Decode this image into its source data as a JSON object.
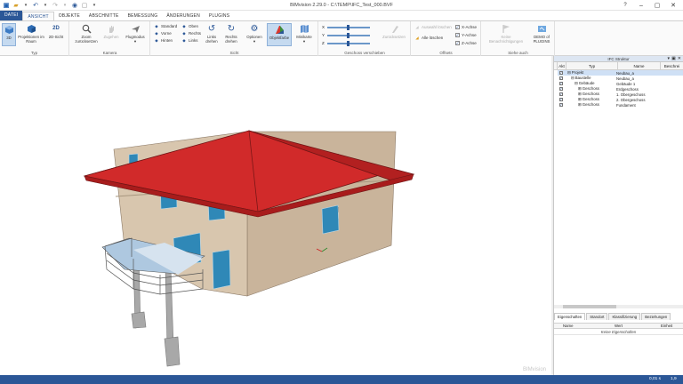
{
  "window": {
    "title": "BIMvision 2.29.0 - C:\\TEMP\\IFC_Test_000.BVF"
  },
  "tabs": [
    {
      "label": "DATEI"
    },
    {
      "label": "ANSICHT"
    },
    {
      "label": "OBJEKTE"
    },
    {
      "label": "ABSCHNITTE"
    },
    {
      "label": "BEMESSUNG"
    },
    {
      "label": "ÄNDERUNGEN"
    },
    {
      "label": "PLUGINS"
    }
  ],
  "ribbon": {
    "typ": {
      "name": "Typ",
      "btn_3d": "3D",
      "btn_projektionen": "Projektionen im Raum",
      "btn_2d": "2D-Sicht"
    },
    "kamera": {
      "name": "Kamera",
      "btn_zoom": "Zoom zurücksetzen",
      "btn_zugehen": "Zugehen",
      "btn_flugmodus": "Flugmodus"
    },
    "sicht": {
      "name": "Sicht",
      "standard": "Standard",
      "vorne": "Vorne",
      "hinten": "Hinten",
      "oben": "Oben",
      "rechts": "Rechts",
      "links": "Links",
      "links_drehen": "Links drehen",
      "rechts_drehen": "Rechts drehen",
      "optionen": "Optionen",
      "objektfarbe": "Objektfarbe",
      "minikarte": "Minikarte"
    },
    "geschoss": {
      "name": "Geschoss verschieben",
      "x": "X",
      "y": "Y",
      "z": "Z",
      "zuruecksetzen": "Zurücksetzen"
    },
    "offsets": {
      "name": "Offsets",
      "auswahl_loeschen": "Auswahl löschen",
      "alle_loeschen": "Alle löschen",
      "x_achse": "X-Achse",
      "y_achse": "Y-Achse",
      "z_achse": "Z-Achse"
    },
    "siehe_auch": {
      "name": "Siehe auch",
      "keine_benachrichtigungen": "Keine Benachrichtigungen",
      "demo_plugins": "DEMO of PLUGINS"
    }
  },
  "ifc_panel": {
    "title": "IFC Struktur",
    "columns": {
      "akt": "Akt",
      "typ": "Typ",
      "name": "Name",
      "beschr": "Beschrei"
    },
    "rows": [
      {
        "typ": "Projekt",
        "name": "Neubau_a"
      },
      {
        "typ": "Baustelle",
        "name": "Neubau_a"
      },
      {
        "typ": "Gebäude",
        "name": "Gebäude 1"
      },
      {
        "typ": "Geschoss",
        "name": "Erdgeschoss"
      },
      {
        "typ": "Geschoss",
        "name": "1. Obergeschoss"
      },
      {
        "typ": "Geschoss",
        "name": "2. Obergeschoss"
      },
      {
        "typ": "Geschoss",
        "name": "Fundament"
      }
    ]
  },
  "props_panel": {
    "tabs": [
      {
        "label": "Eigenschaften"
      },
      {
        "label": "Standort"
      },
      {
        "label": "Klassifizierung"
      },
      {
        "label": "Beziehungen"
      }
    ],
    "col_name": "Name",
    "col_wert": "Wert",
    "col_einheit": "Einheit",
    "empty_text": "Keine Eigenschaften"
  },
  "viewport": {
    "watermark": "BIMvision"
  },
  "status": {
    "left": "0,01 s",
    "right": "1,9"
  }
}
